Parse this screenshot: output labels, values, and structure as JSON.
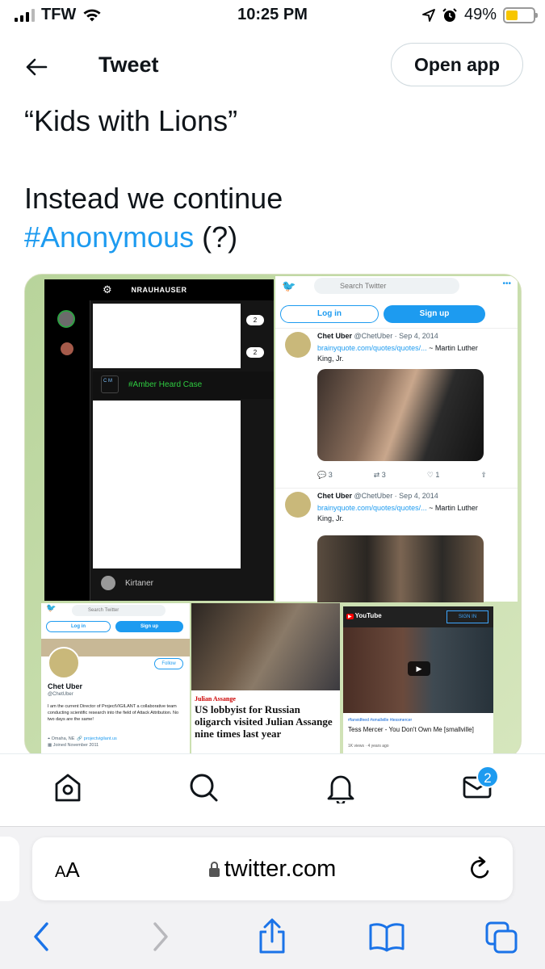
{
  "status_bar": {
    "carrier": "TFW",
    "time": "10:25 PM",
    "battery": "49%"
  },
  "header": {
    "title": "Tweet",
    "open_app_label": "Open app"
  },
  "tweet": {
    "line1": "“Kids with Lions”",
    "line2": "Instead we continue",
    "hashtag": "#Anonymous",
    "suffix": " (?)"
  },
  "media": {
    "dark_panel": {
      "header": "NRAUHAUSER",
      "count1": "2",
      "count2": "2",
      "amber_badge": "C M",
      "amber_label": "#Amber Heard Case",
      "footer_name": "Kirtaner"
    },
    "right_panel": {
      "search_placeholder": "Search Twitter",
      "login": "Log in",
      "signup": "Sign up",
      "tweets": [
        {
          "name": "Chet Uber",
          "handle": "@ChetUber · Sep 4, 2014",
          "link": "brainyquote.com/quotes/quotes/...",
          "text": " ~ Martin Luther King, Jr.",
          "replies": "3",
          "retweets": "3",
          "likes": "1"
        },
        {
          "name": "Chet Uber",
          "handle": "@ChetUber · Sep 4, 2014",
          "link": "brainyquote.com/quotes/quotes/...",
          "text": " ~ Martin Luther King, Jr."
        }
      ]
    },
    "profile_panel": {
      "search_placeholder": "Search Twitter",
      "login": "Log in",
      "signup": "Sign up",
      "follow": "Follow",
      "name": "Chet Uber",
      "handle": "@ChetUber",
      "bio": "I am the current Director of ProjectVIGILANT a collaborative team conducting scientific research into the field of Attack Attribution. No two days are the same!",
      "location": "Omaha, NE",
      "website": "projectvigilant.us",
      "joined": "Joined November 2011"
    },
    "news_panel": {
      "kicker": "Julian Assange",
      "headline": "US lobbyist for Russian oligarch visited Julian Assange nine times last year"
    },
    "youtube_panel": {
      "logo": "YouTube",
      "sign_in": "SIGN IN",
      "tags": "#fanvidfeed  #smallville  #tessmercer",
      "title": "Tess Mercer - You Don't Own Me [smallville]",
      "views": "1K views · 4 years ago"
    }
  },
  "tabbar": {
    "messages_badge": "2"
  },
  "safari": {
    "aa_label": "AA",
    "url": "twitter.com"
  }
}
